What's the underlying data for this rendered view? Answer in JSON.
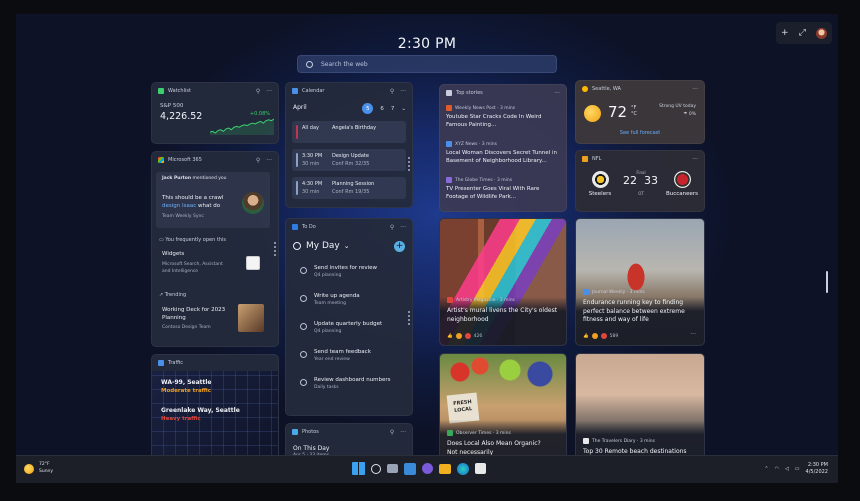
{
  "clock": "2:30 PM",
  "search": {
    "placeholder": "Search the web"
  },
  "topbar": {
    "add": "+",
    "expand": "⤢"
  },
  "watchlist": {
    "title": "Watchlist",
    "symbol": "S&P 500",
    "value": "4,226.52",
    "change": "+0.08%",
    "chart": [
      30,
      31,
      29,
      32,
      33,
      31,
      34,
      35,
      33,
      36,
      37,
      36,
      38,
      39,
      38,
      40,
      41,
      40,
      42,
      43,
      41,
      44,
      45,
      44,
      46
    ]
  },
  "calendar": {
    "title": "Calendar",
    "month": "April",
    "days": [
      "5",
      "6",
      "7"
    ],
    "events": [
      {
        "time": "All day",
        "duration": "",
        "name": "Angela's Birthday",
        "detail": "",
        "color": "#c2364a"
      },
      {
        "time": "3:30 PM",
        "duration": "30 min",
        "name": "Design Update",
        "detail": "Conf Rm 32/35",
        "color": "#8aa0c8"
      },
      {
        "time": "4:30 PM",
        "duration": "30 min",
        "name": "Planning Session",
        "detail": "Conf Rm 19/35",
        "color": "#8aa0c8"
      }
    ]
  },
  "m365": {
    "title": "Microsoft 365",
    "mention_user": "Jack Purton",
    "mention_suffix": "mentioned you",
    "mention_text1": "This should be a crawl",
    "mention_link": "design",
    "mention_after": "Isaac",
    "mention_text2": "what do",
    "mention_source": "Team Weekly Sync",
    "recent_label": "You frequently open this",
    "recent_title": "Widgets",
    "recent_desc1": "Microsoft Search, Assistant",
    "recent_desc2": "and Intelligence",
    "trending_label": "Trending",
    "trending_title1": "Working Deck for 2023",
    "trending_title2": "Planning",
    "trending_source": "Contoso Design Team"
  },
  "traffic": {
    "title": "Traffic",
    "routes": [
      {
        "road": "WA-99, Seattle",
        "status": "Moderate traffic",
        "color": "#f0a020"
      },
      {
        "road": "Greenlake Way, Seattle",
        "status": "Heavy traffic",
        "color": "#e0463c"
      }
    ]
  },
  "todo": {
    "title": "To Do",
    "list": "My Day",
    "tasks": [
      {
        "title": "Send invites for review",
        "sub": "Q4 planning"
      },
      {
        "title": "Write up agenda",
        "sub": "Team meeting"
      },
      {
        "title": "Update quarterly budget",
        "sub": "Q4 planning"
      },
      {
        "title": "Send team feedback",
        "sub": "Year end review"
      },
      {
        "title": "Review dashboard numbers",
        "sub": "Daily tasks"
      }
    ]
  },
  "photos": {
    "title": "Photos",
    "heading": "On This Day",
    "sub": "Apr 5 · 33 items"
  },
  "top_stories": {
    "title": "Top stories",
    "items": [
      {
        "source": "Weekly News Post · 3 mins",
        "line1": "Youtube Star Cracks Code In Weird",
        "line2": "Famous Painting...",
        "color": "#e05a2a"
      },
      {
        "source": "XYZ News · 3 mins",
        "line1": "Local Woman Discovers Secret Tunnel in",
        "line2": "Basement of Neighborhood Library...",
        "color": "#4a8fe8"
      },
      {
        "source": "The Globe Times · 3 mins",
        "line1": "TV Presenter Goes Viral With Rare",
        "line2": "Footage of Wildlife Park...",
        "color": "#8a6ad8"
      }
    ]
  },
  "weather": {
    "location": "Seattle, WA",
    "temp": "72",
    "unit_f": "°F",
    "unit_c": "°C",
    "condition": "Strong UV today",
    "precip": "0%",
    "link": "See full forecast"
  },
  "nfl": {
    "title": "NFL",
    "home": {
      "name": "Steelers",
      "score": "22",
      "color": "#f5c224"
    },
    "away": {
      "name": "Buccaneers",
      "score": "33",
      "color": "#c8232c"
    },
    "meta": "Final",
    "ot": "OT"
  },
  "news_cards": [
    {
      "source": "Artistry Magazine · 3 mins",
      "line1": "Artist's mural livens the City's oldest",
      "line2": "neighborhood",
      "reacts": "426"
    },
    {
      "source": "Journal Weekly · 3 mins",
      "line1": "Endurance running key to finding",
      "line2": "perfect balance between extreme",
      "line3": "fitness and way of life",
      "reacts": "589"
    },
    {
      "source": "Observer Times · 3 mins",
      "line1": "Does Local Also Mean Organic?",
      "line2": "Not necessarily",
      "crate_text": "FRESH LOCAL"
    },
    {
      "source": "The Travelers Diary · 3 mins",
      "line1": "Top 30 Remote beach destinations"
    }
  ],
  "taskbar": {
    "weather_temp": "72°F",
    "weather_cond": "Sunny",
    "time": "2:30 PM",
    "date": "4/5/2022"
  }
}
